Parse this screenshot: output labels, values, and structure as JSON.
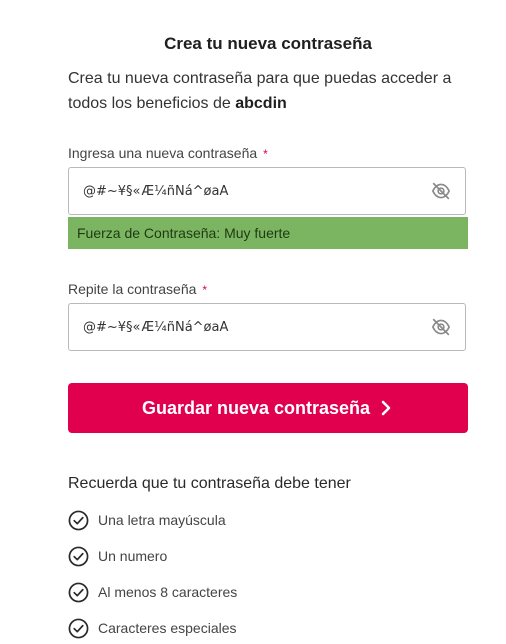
{
  "header": {
    "title": "Crea tu nueva contraseña",
    "intro_text": "Crea tu nueva contraseña para que puedas acceder a todos los beneficios de ",
    "intro_brand": "abcdin"
  },
  "form": {
    "new_password": {
      "label": "Ingresa una nueva contraseña",
      "required_mark": "*",
      "value": "@#~¥§«Æ¼ñÑá^øaA",
      "toggle_icon": "eye-slash-icon"
    },
    "strength": {
      "text": "Fuerza de Contraseña: Muy fuerte",
      "color": "#7cb562"
    },
    "repeat_password": {
      "label": "Repite la contraseña",
      "required_mark": "*",
      "value": "@#~¥§«Æ¼ñÑá^øaA",
      "toggle_icon": "eye-slash-icon"
    },
    "submit": {
      "label": "Guardar nueva contraseña",
      "icon": "chevron-right-icon",
      "color": "#e0004d"
    }
  },
  "requirements": {
    "title": "Recuerda que tu contraseña debe tener",
    "items": [
      {
        "label": "Una letra mayúscula",
        "icon": "check-circle-icon"
      },
      {
        "label": "Un numero",
        "icon": "check-circle-icon"
      },
      {
        "label": "Al menos 8 caracteres",
        "icon": "check-circle-icon"
      },
      {
        "label": "Caracteres especiales",
        "icon": "check-circle-icon"
      }
    ]
  }
}
